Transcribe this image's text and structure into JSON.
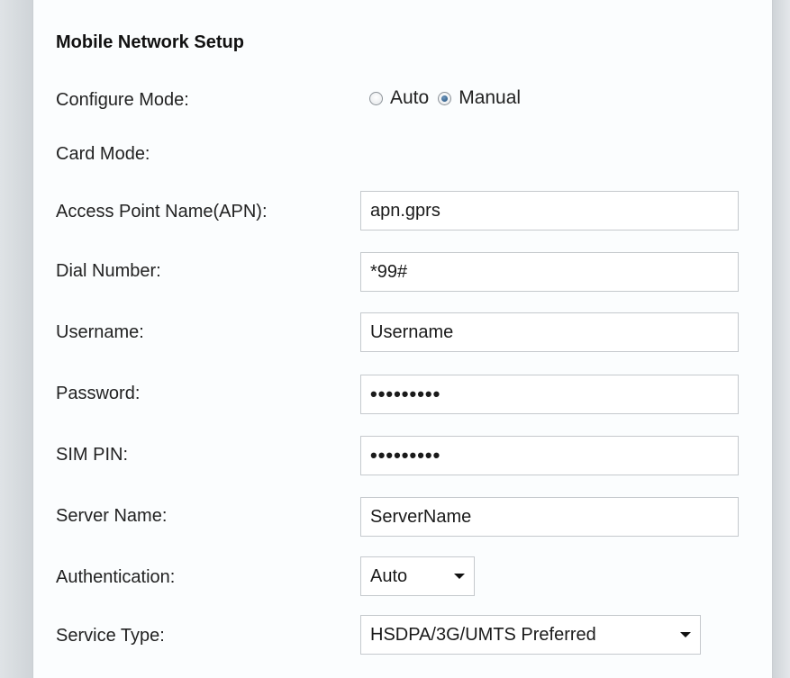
{
  "section": {
    "title": "Mobile Network Setup"
  },
  "configure_mode": {
    "label": "Configure Mode:",
    "options": [
      {
        "label": "Auto",
        "checked": false
      },
      {
        "label": "Manual",
        "checked": true
      }
    ]
  },
  "card_mode": {
    "label": "Card Mode:"
  },
  "apn": {
    "label": "Access Point Name(APN):",
    "value": "apn.gprs"
  },
  "dial_number": {
    "label": "Dial Number:",
    "value": "*99#"
  },
  "username": {
    "label": "Username:",
    "value": "Username"
  },
  "password": {
    "label": "Password:",
    "value": "•••••••••"
  },
  "sim_pin": {
    "label": "SIM PIN:",
    "value": "•••••••••"
  },
  "server_name": {
    "label": "Server Name:",
    "value": "ServerName"
  },
  "authentication": {
    "label": "Authentication:",
    "selected": "Auto"
  },
  "service_type": {
    "label": "Service Type:",
    "selected": "HSDPA/3G/UMTS Preferred"
  }
}
